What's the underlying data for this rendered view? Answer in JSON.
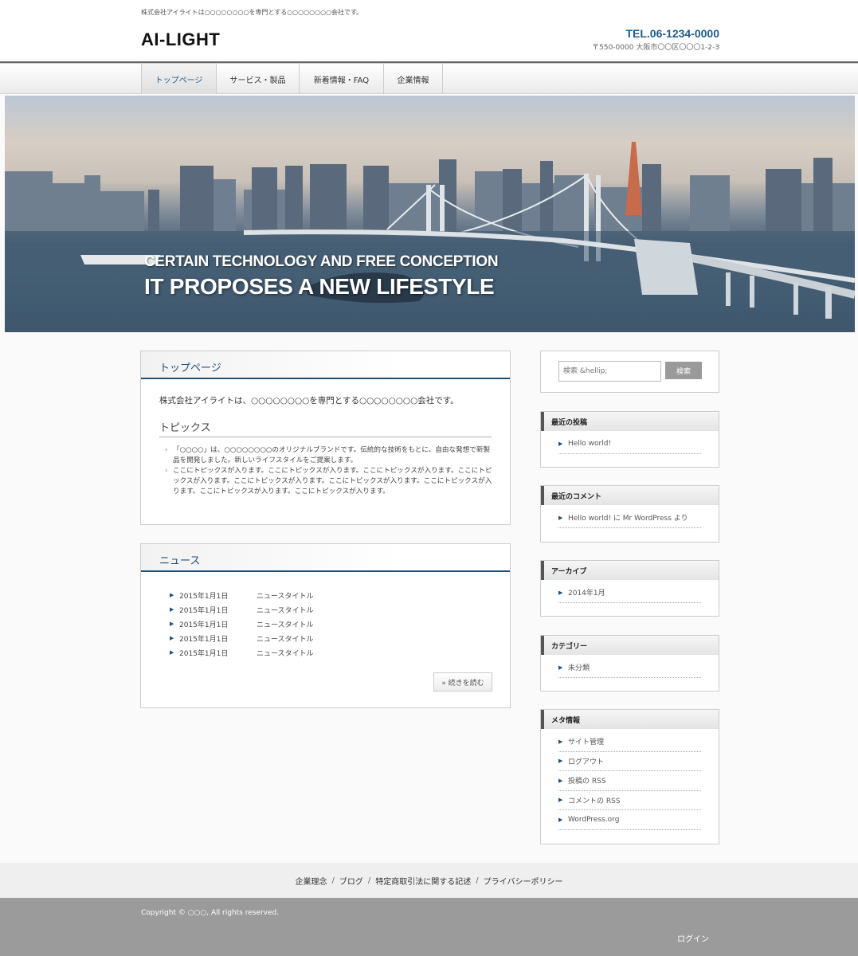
{
  "header": {
    "tagline": "株式会社アイライトは○○○○○○○○を専門とする○○○○○○○○会社です。",
    "logo": "AI-LIGHT",
    "tel": "TEL.06-1234-0000",
    "address": "〒550-0000 大阪市〇〇区〇〇〇1-2-3"
  },
  "nav": {
    "items": [
      {
        "label": "トップページ",
        "active": true
      },
      {
        "label": "サービス・製品"
      },
      {
        "label": "新着情報・FAQ"
      },
      {
        "label": "企業情報"
      }
    ]
  },
  "hero": {
    "line1": "CERTAIN TECHNOLOGY AND FREE CONCEPTION",
    "line2": "IT PROPOSES A NEW LIFESTYLE"
  },
  "top_page": {
    "title": "トップページ",
    "intro": "株式会社アイライトは、○○○○○○○○を専門とする○○○○○○○○会社です。",
    "topics_title": "トピックス",
    "topics": [
      "「○○○○」は、○○○○○○○○のオリジナルブランドです。伝統的な技術をもとに、自由な発想で新製品を開発しました。新しいライフスタイルをご提案します。",
      "ここにトピックスが入ります。ここにトピックスが入ります。ここにトピックスが入ります。ここにトピックスが入ります。ここにトピックスが入ります。ここにトピックスが入ります。ここにトピックスが入ります。ここにトピックスが入ります。ここにトピックスが入ります。"
    ]
  },
  "news": {
    "title": "ニュース",
    "items": [
      {
        "date": "2015年1月1日",
        "title": "ニュースタイトル"
      },
      {
        "date": "2015年1月1日",
        "title": "ニュースタイトル"
      },
      {
        "date": "2015年1月1日",
        "title": "ニュースタイトル"
      },
      {
        "date": "2015年1月1日",
        "title": "ニュースタイトル"
      },
      {
        "date": "2015年1月1日",
        "title": "ニュースタイトル"
      }
    ],
    "more_label": "» 続きを読む"
  },
  "sidebar": {
    "search_placeholder": "検索 &hellip;",
    "search_button": "検索",
    "widgets": [
      {
        "title": "最近の投稿",
        "items": [
          "Hello world!"
        ]
      },
      {
        "title": "最近のコメント",
        "items": [
          "Hello world! に Mr WordPress より"
        ]
      },
      {
        "title": "アーカイブ",
        "items": [
          "2014年1月"
        ]
      },
      {
        "title": "カテゴリー",
        "items": [
          "未分類"
        ]
      },
      {
        "title": "メタ情報",
        "items": [
          "サイト管理",
          "ログアウト",
          "投稿の RSS",
          "コメントの RSS",
          "WordPress.org"
        ]
      }
    ]
  },
  "footer": {
    "links": [
      "企業理念",
      "ブログ",
      "特定商取引法に関する記述",
      "プライバシーポリシー"
    ],
    "separator": "/",
    "copyright": "Copyright © ○○○, All rights reserved.",
    "login": "ログイン"
  }
}
